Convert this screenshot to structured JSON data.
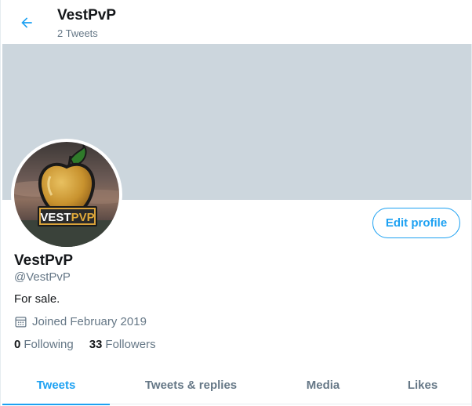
{
  "header": {
    "title": "VestPvP",
    "tweet_count": "2 Tweets"
  },
  "profile": {
    "name": "VestPvP",
    "handle": "@VestPvP",
    "bio": "For sale.",
    "joined": "Joined February 2019",
    "following_count": "0",
    "following_label": "Following",
    "followers_count": "33",
    "followers_label": "Followers",
    "edit_label": "Edit profile",
    "avatar_text": "VESTPVP"
  },
  "tabs": [
    {
      "label": "Tweets",
      "active": true
    },
    {
      "label": "Tweets & replies",
      "active": false
    },
    {
      "label": "Media",
      "active": false
    },
    {
      "label": "Likes",
      "active": false
    }
  ],
  "colors": {
    "accent": "#1da1f2",
    "banner": "#ccd6dd",
    "muted": "#657786"
  },
  "icons": {
    "back": "arrow-left-icon",
    "calendar": "calendar-icon"
  }
}
